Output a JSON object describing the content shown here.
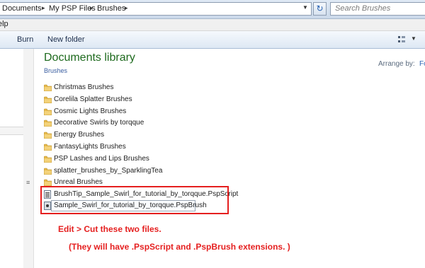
{
  "address_bar": {
    "crumbs": [
      "Documents",
      "My PSP Files",
      "Brushes"
    ],
    "search_placeholder": "Search Brushes"
  },
  "menubar": {
    "help_fragment": "elp"
  },
  "toolbar": {
    "burn": "Burn",
    "new_folder": "New folder"
  },
  "library": {
    "title": "Documents library",
    "subtitle": "Brushes",
    "arrange_label": "Arrange by:",
    "arrange_value": "Fo"
  },
  "folders": [
    "Christmas Brushes",
    "Corelila Splatter Brushes",
    "Cosmic Lights Brushes",
    "Decorative Swirls by torqque",
    "Energy Brushes",
    "FantasyLights Brushes",
    "PSP Lashes and Lips Brushes",
    "splatter_brushes_by_SparklingTea",
    "Unreal Brushes"
  ],
  "files": [
    {
      "name": "BrushTip_Sample_Swirl_for_tutorial_by_torqque.PspScript",
      "icon": "script-file-icon"
    },
    {
      "name": "Sample_Swirl_for_tutorial_by_torqque.PspBrush",
      "icon": "brush-file-icon"
    }
  ],
  "annotation": {
    "line1": "Edit > Cut these two files.",
    "line2": "(They will have .PspScript and .PspBrush extensions. )"
  },
  "colors": {
    "annotation": "#e51f1f",
    "library_title": "#1e6a1e"
  }
}
